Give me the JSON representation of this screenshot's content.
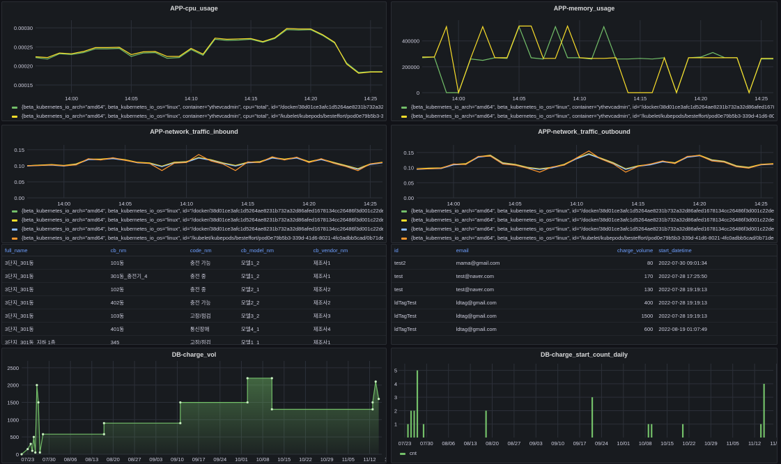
{
  "colors": {
    "green": "#73bf69",
    "yellow": "#fade2a",
    "orange": "#ff9830",
    "blue": "#8ab8ff",
    "grid": "#2c3039",
    "axis": "#ccccdc"
  },
  "cpu": {
    "title": "APP-cpu_usage",
    "legend": [
      {
        "text": "{beta_kubernetes_io_arch=\"amd64\", beta_kubernetes_io_os=\"linux\", container=\"ythevcadmin\", cpu=\"total\", id=\"/docker/38d01ce3afc1d5264ae8231b732a32d86afed1678134cc26486f3d001c22de9f/kube",
        "color": "green"
      },
      {
        "text": "{beta_kubernetes_io_arch=\"amd64\", beta_kubernetes_io_os=\"linux\", container=\"ythevcadmin\", cpu=\"total\", id=\"/kubelet/kubepods/besteffort/pod0e79b5b3-339d-41d6-8021-4fc0adbb5cad/0b71dee8d8a2",
        "color": "yellow"
      }
    ]
  },
  "memory": {
    "title": "APP-memory_usage",
    "legend": [
      {
        "text": "{beta_kubernetes_io_arch=\"amd64\", beta_kubernetes_io_os=\"linux\", container=\"ythevcadmin\", id=\"/docker/38d01ce3afc1d5264ae8231b732a32d86afed1678134cc26486f3d001c22de9f/kubepods/bes",
        "color": "green"
      },
      {
        "text": "{beta_kubernetes_io_arch=\"amd64\", beta_kubernetes_io_os=\"linux\", container=\"ythevcadmin\", id=\"/kubelet/kubepods/besteffort/pod0e79b5b3-339d-41d6-8021-4fc0adbb5cad/0b71",
        "color": "yellow"
      }
    ]
  },
  "inbound": {
    "title": "APP-network_traffic_inbound",
    "legend": [
      {
        "text": "{beta_kubernetes_io_arch=\"amd64\", beta_kubernetes_io_os=\"linux\", id=\"/docker/38d01ce3afc1d5264ae8231b732a32d86afed1678134cc26486f3d001c22de9f/kubepods/besteffort",
        "color": "green"
      },
      {
        "text": "{beta_kubernetes_io_arch=\"amd64\", beta_kubernetes_io_os=\"linux\", id=\"/docker/38d01ce3afc1d5264ae8231b732a32d86afed1678134cc26486f3d001c22de9f/kubepods/besteffort",
        "color": "yellow"
      },
      {
        "text": "{beta_kubernetes_io_arch=\"amd64\", beta_kubernetes_io_os=\"linux\", id=\"/docker/38d01ce3afc1d5264ae8231b732a32d86afed1678134cc26486f3d001c22de9f/kubepods/besteffort",
        "color": "blue"
      },
      {
        "text": "{beta_kubernetes_io_arch=\"amd64\", beta_kubernetes_io_os=\"linux\", id=\"/kubelet/kubepods/besteffort/pod0e79b5b3-339d-41d6-8021-4fc0adbb5cad/0b71dee8d8a2",
        "color": "orange"
      }
    ]
  },
  "outbound": {
    "title": "APP-network_traffic_outbound",
    "legend": [
      {
        "text": "{beta_kubernetes_io_arch=\"amd64\", beta_kubernetes_io_os=\"linux\", id=\"/docker/38d01ce3afc1d5264ae8231b732a32d86afed1678134cc26486f3d001c22de9f/kubepods/besteffort",
        "color": "green"
      },
      {
        "text": "{beta_kubernetes_io_arch=\"amd64\", beta_kubernetes_io_os=\"linux\", id=\"/docker/38d01ce3afc1d5264ae8231b732a32d86afed1678134cc26486f3d001c22de9f/kubepods/besteffort",
        "color": "yellow"
      },
      {
        "text": "{beta_kubernetes_io_arch=\"amd64\", beta_kubernetes_io_os=\"linux\", id=\"/docker/38d01ce3afc1d5264ae8231b732a32d86afed1678134cc26486f3d001c22de9f/kubepods/besteffort",
        "color": "blue"
      },
      {
        "text": "{beta_kubernetes_io_arch=\"amd64\", beta_kubernetes_io_os=\"linux\", id=\"/kubelet/kubepods/besteffort/pod0e79b5b3-339d-41d6-8021-4fc0adbb5cad/0b71dee8d8a2",
        "color": "orange"
      }
    ]
  },
  "table1": {
    "headers": [
      "full_name",
      "cb_nm",
      "code_nm",
      "cb_model_nm",
      "cb_vendor_nm"
    ],
    "rows": [
      [
        "3단지_301동",
        "101동",
        "충전 가능",
        "모델1_2",
        "제조사1"
      ],
      [
        "3단지_301동",
        "301동_충전기_4",
        "충전 중",
        "모델1_2",
        "제조사1"
      ],
      [
        "3단지_301동",
        "102동",
        "충전 중",
        "모델2_1",
        "제조사2"
      ],
      [
        "3단지_301동",
        "402동",
        "충전 가능",
        "모델2_2",
        "제조사2"
      ],
      [
        "3단지_301동",
        "103동",
        "고장/점검",
        "모델3_2",
        "제조사3"
      ],
      [
        "3단지_301동",
        "401동",
        "통신장애",
        "모델4_1",
        "제조사4"
      ],
      [
        "3단지_301동_지하 1층",
        "345",
        "고장/점검",
        "모델1_1",
        "제조사1"
      ]
    ]
  },
  "table2": {
    "headers": [
      "id",
      "email",
      "charge_volume",
      "start_datetime"
    ],
    "rows": [
      [
        "test2",
        "mama@gmail.com",
        "80",
        "2022-07-30 09:01:34"
      ],
      [
        "test",
        "test@naver.com",
        "170",
        "2022-07-28 17:25:50"
      ],
      [
        "test",
        "test@naver.com",
        "130",
        "2022-07-28 19:19:13"
      ],
      [
        "ldTagTest",
        "ldtag@gmail.com",
        "400",
        "2022-07-28 19:19:13"
      ],
      [
        "ldTagTest",
        "ldtag@gmail.com",
        "1500",
        "2022-07-28 19:19:13"
      ],
      [
        "ldTagTest",
        "ldtag@gmail.com",
        "600",
        "2022-08-19 01:07:49"
      ]
    ]
  },
  "vol": {
    "title": "DB-charge_vol"
  },
  "daily": {
    "title": "DB-charge_start_count_daily",
    "legend": "cnt"
  },
  "chart_data": [
    {
      "type": "line",
      "title": "APP-cpu_usage",
      "x": [
        "13:57",
        "13:58",
        "13:59",
        "14:00",
        "14:01",
        "14:02",
        "14:03",
        "14:04",
        "14:05",
        "14:06",
        "14:07",
        "14:08",
        "14:09",
        "14:10",
        "14:11",
        "14:12",
        "14:13",
        "14:14",
        "14:15",
        "14:16",
        "14:17",
        "14:18",
        "14:19",
        "14:20",
        "14:21",
        "14:22",
        "14:23",
        "14:24",
        "14:25",
        "14:26"
      ],
      "xticks": [
        "14:00",
        "14:05",
        "14:10",
        "14:15",
        "14:20",
        "14:25"
      ],
      "yticks": [
        "0.00015",
        "0.00020",
        "0.00025",
        "0.00030"
      ],
      "ylim": [
        0.00013,
        0.00032
      ],
      "series": [
        {
          "color": "green",
          "values": [
            0.000222,
            0.000218,
            0.000232,
            0.00023,
            0.000235,
            0.000245,
            0.000245,
            0.000246,
            0.000225,
            0.000234,
            0.000235,
            0.00022,
            0.000222,
            0.000243,
            0.000228,
            0.00027,
            0.000267,
            0.000268,
            0.00027,
            0.000262,
            0.000272,
            0.000295,
            0.000294,
            0.000295,
            0.00028,
            0.00026,
            0.000208,
            0.000183,
            0.000185,
            0.000185
          ]
        },
        {
          "color": "yellow",
          "values": [
            0.000224,
            0.000222,
            0.000234,
            0.000232,
            0.000238,
            0.000248,
            0.000248,
            0.000249,
            0.00023,
            0.000237,
            0.000238,
            0.000225,
            0.000225,
            0.000246,
            0.000231,
            0.000273,
            0.00027,
            0.000271,
            0.000272,
            0.000264,
            0.000274,
            0.000298,
            0.000297,
            0.000297,
            0.000282,
            0.000262,
            0.000205,
            0.000181,
            0.000184,
            0.000184
          ]
        }
      ]
    },
    {
      "type": "line",
      "title": "APP-memory_usage",
      "x": [
        "13:57",
        "13:58",
        "13:59",
        "14:00",
        "14:01",
        "14:02",
        "14:03",
        "14:04",
        "14:05",
        "14:06",
        "14:07",
        "14:08",
        "14:09",
        "14:10",
        "14:11",
        "14:12",
        "14:13",
        "14:14",
        "14:15",
        "14:16",
        "14:17",
        "14:18",
        "14:19",
        "14:20",
        "14:21",
        "14:22",
        "14:23",
        "14:24",
        "14:25",
        "14:26"
      ],
      "xticks": [
        "14:00",
        "14:05",
        "14:10",
        "14:15",
        "14:20",
        "14:25"
      ],
      "yticks": [
        "0",
        "200000",
        "400000"
      ],
      "ylim": [
        0,
        560000
      ],
      "series": [
        {
          "color": "green",
          "values": [
            270000,
            275000,
            0,
            0,
            260000,
            250000,
            270000,
            265000,
            510000,
            270000,
            260000,
            510000,
            270000,
            270000,
            260000,
            510000,
            260000,
            260000,
            265000,
            260000,
            270000,
            0,
            270000,
            275000,
            310000,
            270000,
            270000,
            0,
            260000,
            260000
          ]
        },
        {
          "color": "yellow",
          "values": [
            275000,
            275000,
            510000,
            0,
            265000,
            510000,
            270000,
            270000,
            515000,
            515000,
            265000,
            265000,
            515000,
            270000,
            265000,
            265000,
            270000,
            0,
            0,
            0,
            270000,
            0,
            270000,
            270000,
            270000,
            270000,
            270000,
            0,
            265000,
            265000
          ]
        }
      ]
    },
    {
      "type": "line",
      "title": "APP-network_traffic_inbound",
      "x": [
        "13:57",
        "13:58",
        "13:59",
        "14:00",
        "14:01",
        "14:02",
        "14:03",
        "14:04",
        "14:05",
        "14:06",
        "14:07",
        "14:08",
        "14:09",
        "14:10",
        "14:11",
        "14:12",
        "14:13",
        "14:14",
        "14:15",
        "14:16",
        "14:17",
        "14:18",
        "14:19",
        "14:20",
        "14:21",
        "14:22",
        "14:23",
        "14:24",
        "14:25",
        "14:26"
      ],
      "xticks": [
        "14:00",
        "14:05",
        "14:10",
        "14:15",
        "14:20",
        "14:25"
      ],
      "yticks": [
        "0.00",
        "0.05",
        "0.10",
        "0.15"
      ],
      "ylim": [
        0,
        0.165
      ],
      "series": [
        {
          "color": "green",
          "values": [
            0.1,
            0.102,
            0.103,
            0.1,
            0.105,
            0.12,
            0.12,
            0.123,
            0.118,
            0.11,
            0.108,
            0.098,
            0.11,
            0.112,
            0.125,
            0.118,
            0.108,
            0.1,
            0.11,
            0.112,
            0.125,
            0.12,
            0.125,
            0.112,
            0.12,
            0.11,
            0.1,
            0.09,
            0.105,
            0.11
          ]
        },
        {
          "color": "yellow",
          "values": [
            0.1,
            0.102,
            0.104,
            0.101,
            0.106,
            0.121,
            0.121,
            0.124,
            0.119,
            0.111,
            0.109,
            0.099,
            0.111,
            0.113,
            0.126,
            0.119,
            0.109,
            0.101,
            0.111,
            0.113,
            0.126,
            0.121,
            0.126,
            0.113,
            0.121,
            0.111,
            0.101,
            0.091,
            0.106,
            0.111
          ]
        },
        {
          "color": "blue",
          "values": [
            0.099,
            0.101,
            0.102,
            0.099,
            0.104,
            0.119,
            0.119,
            0.122,
            0.117,
            0.109,
            0.107,
            0.097,
            0.109,
            0.111,
            0.124,
            0.117,
            0.107,
            0.099,
            0.109,
            0.111,
            0.124,
            0.119,
            0.124,
            0.111,
            0.119,
            0.109,
            0.099,
            0.089,
            0.104,
            0.109
          ]
        },
        {
          "color": "orange",
          "values": [
            0.1,
            0.101,
            0.103,
            0.1,
            0.103,
            0.122,
            0.118,
            0.125,
            0.117,
            0.11,
            0.107,
            0.085,
            0.108,
            0.11,
            0.135,
            0.115,
            0.105,
            0.085,
            0.112,
            0.11,
            0.128,
            0.118,
            0.127,
            0.11,
            0.122,
            0.108,
            0.098,
            0.085,
            0.106,
            0.11
          ]
        }
      ]
    },
    {
      "type": "line",
      "title": "APP-network_traffic_outbound",
      "x": [
        "13:57",
        "13:58",
        "13:59",
        "14:00",
        "14:01",
        "14:02",
        "14:03",
        "14:04",
        "14:05",
        "14:06",
        "14:07",
        "14:08",
        "14:09",
        "14:10",
        "14:11",
        "14:12",
        "14:13",
        "14:14",
        "14:15",
        "14:16",
        "14:17",
        "14:18",
        "14:19",
        "14:20",
        "14:21",
        "14:22",
        "14:23",
        "14:24",
        "14:25",
        "14:26"
      ],
      "xticks": [
        "14:00",
        "14:05",
        "14:10",
        "14:15",
        "14:20",
        "14:25"
      ],
      "yticks": [
        "0.00",
        "0.05",
        "0.10",
        "0.15"
      ],
      "ylim": [
        0,
        0.175
      ],
      "series": [
        {
          "color": "green",
          "values": [
            0.095,
            0.097,
            0.098,
            0.11,
            0.112,
            0.135,
            0.14,
            0.115,
            0.11,
            0.1,
            0.095,
            0.1,
            0.11,
            0.13,
            0.145,
            0.13,
            0.115,
            0.095,
            0.105,
            0.11,
            0.12,
            0.115,
            0.135,
            0.14,
            0.125,
            0.12,
            0.105,
            0.1,
            0.11,
            0.112
          ]
        },
        {
          "color": "yellow",
          "values": [
            0.096,
            0.098,
            0.099,
            0.111,
            0.113,
            0.136,
            0.141,
            0.116,
            0.111,
            0.101,
            0.096,
            0.101,
            0.111,
            0.131,
            0.146,
            0.131,
            0.116,
            0.096,
            0.106,
            0.111,
            0.121,
            0.116,
            0.136,
            0.141,
            0.126,
            0.121,
            0.106,
            0.101,
            0.111,
            0.113
          ]
        },
        {
          "color": "blue",
          "values": [
            0.094,
            0.096,
            0.097,
            0.109,
            0.111,
            0.134,
            0.139,
            0.114,
            0.109,
            0.099,
            0.094,
            0.099,
            0.109,
            0.129,
            0.144,
            0.129,
            0.114,
            0.094,
            0.104,
            0.109,
            0.119,
            0.114,
            0.134,
            0.139,
            0.124,
            0.119,
            0.104,
            0.099,
            0.109,
            0.111
          ]
        },
        {
          "color": "orange",
          "values": [
            0.095,
            0.096,
            0.098,
            0.112,
            0.11,
            0.137,
            0.138,
            0.112,
            0.108,
            0.098,
            0.085,
            0.102,
            0.108,
            0.132,
            0.155,
            0.128,
            0.112,
            0.085,
            0.104,
            0.112,
            0.122,
            0.113,
            0.137,
            0.14,
            0.122,
            0.118,
            0.103,
            0.098,
            0.11,
            0.112
          ]
        }
      ]
    },
    {
      "type": "area",
      "title": "DB-charge_vol",
      "xticks": [
        "07/23",
        "07/30",
        "08/06",
        "08/13",
        "08/20",
        "08/27",
        "09/03",
        "09/10",
        "09/17",
        "09/24",
        "10/01",
        "10/08",
        "10/15",
        "10/22",
        "10/29",
        "11/05",
        "11/12",
        "11/19"
      ],
      "yticks": [
        "0",
        "500",
        "1000",
        "1500",
        "2000",
        "2500"
      ],
      "ylim": [
        0,
        2700
      ],
      "xlim": [
        0,
        118
      ],
      "points": [
        [
          0,
          0
        ],
        [
          2,
          150
        ],
        [
          3,
          300
        ],
        [
          3.5,
          100
        ],
        [
          4,
          500
        ],
        [
          4.5,
          50
        ],
        [
          5,
          2000
        ],
        [
          5.5,
          1500
        ],
        [
          6,
          50
        ],
        [
          7,
          580
        ],
        [
          27,
          580
        ],
        [
          27,
          900
        ],
        [
          52,
          900
        ],
        [
          52,
          1500
        ],
        [
          74,
          1500
        ],
        [
          74,
          2200
        ],
        [
          82,
          2200
        ],
        [
          82,
          1300
        ],
        [
          115,
          1300
        ],
        [
          115,
          1500
        ],
        [
          116,
          2100
        ],
        [
          117,
          1600
        ]
      ],
      "color": "green"
    },
    {
      "type": "bar",
      "title": "DB-charge_start_count_daily",
      "xticks": [
        "07/23",
        "07/30",
        "08/06",
        "08/13",
        "08/20",
        "08/27",
        "09/03",
        "09/10",
        "09/17",
        "09/24",
        "10/01",
        "10/08",
        "10/15",
        "10/22",
        "10/29",
        "11/05",
        "11/12",
        "11/19"
      ],
      "yticks": [
        "1",
        "2",
        "3",
        "4",
        "5"
      ],
      "ylim": [
        0,
        5.5
      ],
      "xlim": [
        0,
        120
      ],
      "series": [
        {
          "name": "cnt",
          "color": "green"
        }
      ],
      "bars": [
        [
          3,
          1
        ],
        [
          4,
          2
        ],
        [
          5,
          2
        ],
        [
          6,
          5
        ],
        [
          8,
          1
        ],
        [
          28,
          2
        ],
        [
          62,
          3
        ],
        [
          80,
          1
        ],
        [
          81,
          1
        ],
        [
          91,
          1
        ],
        [
          116,
          1
        ],
        [
          117,
          4
        ]
      ]
    }
  ]
}
